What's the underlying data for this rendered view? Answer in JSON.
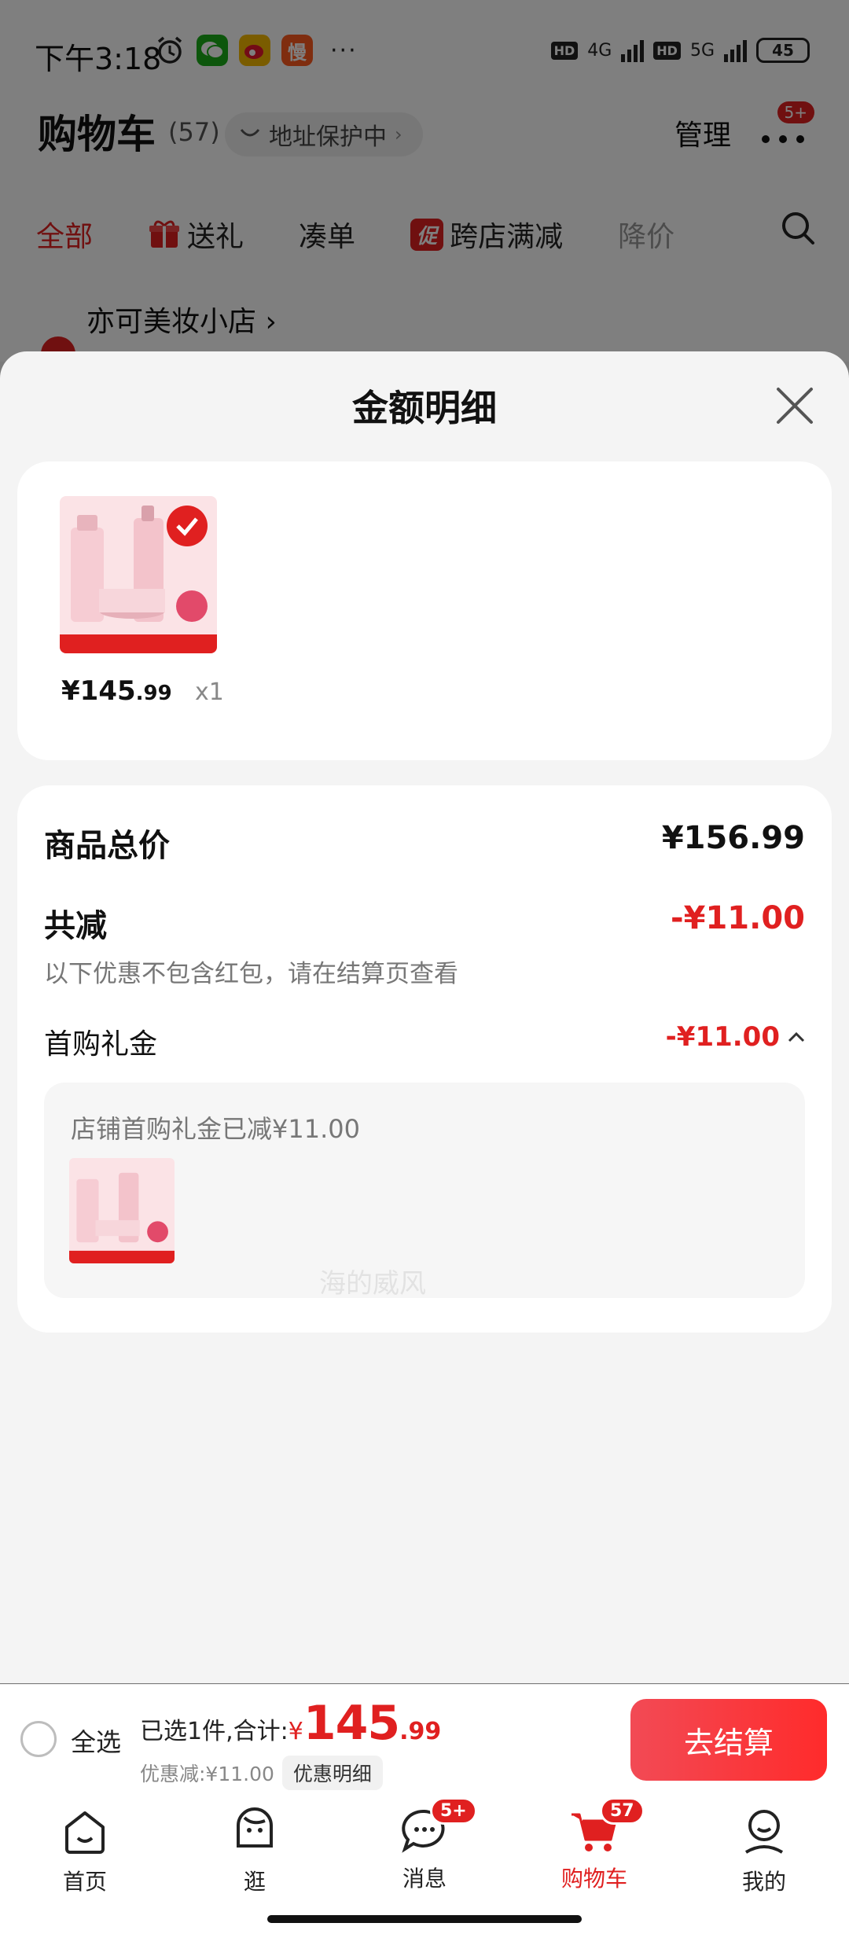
{
  "status_bar": {
    "time": "下午3:18",
    "network_1": "4G",
    "network_2": "5G",
    "hd": "HD",
    "battery": "45",
    "more_dots": "···"
  },
  "cart_header": {
    "title": "购物车",
    "count": "(57)",
    "address_protection": "地址保护中",
    "manage": "管理",
    "more_badge": "5+"
  },
  "filter_tabs": [
    {
      "label": "全部"
    },
    {
      "label": "送礼"
    },
    {
      "label": "凑单"
    },
    {
      "label": "跨店满减",
      "mark": "促"
    },
    {
      "label": "降价"
    }
  ],
  "shop": {
    "name": "亦可美妆小店 ›"
  },
  "sheet": {
    "title": "金额明细",
    "product": {
      "price_int": "¥145",
      "price_dec": ".99",
      "qty": "x1"
    },
    "total_label": "商品总价",
    "total_value": "¥156.99",
    "reduce_label": "共减",
    "reduce_value": "-¥11.00",
    "note": "以下优惠不包含红包，请在结算页查看",
    "first_gift_label": "首购礼金",
    "first_gift_value": "-¥11.00",
    "coupon_text": "店铺首购礼金已减¥11.00",
    "watermark": "海的威风"
  },
  "checkout": {
    "select_all": "全选",
    "summary_prefix": "已选1件,合计:",
    "currency": "¥",
    "total_int": "145",
    "total_dec": ".99",
    "discount": "优惠减:¥11.00",
    "detail_button": "优惠明细",
    "checkout_button": "去结算"
  },
  "bottom_nav": {
    "items": [
      {
        "label": "首页"
      },
      {
        "label": "逛"
      },
      {
        "label": "消息",
        "badge": "5+"
      },
      {
        "label": "购物车",
        "badge": "57"
      },
      {
        "label": "我的"
      }
    ]
  },
  "colors": {
    "accent": "#e02020",
    "background": "#f4f4f4",
    "card": "#ffffff"
  }
}
